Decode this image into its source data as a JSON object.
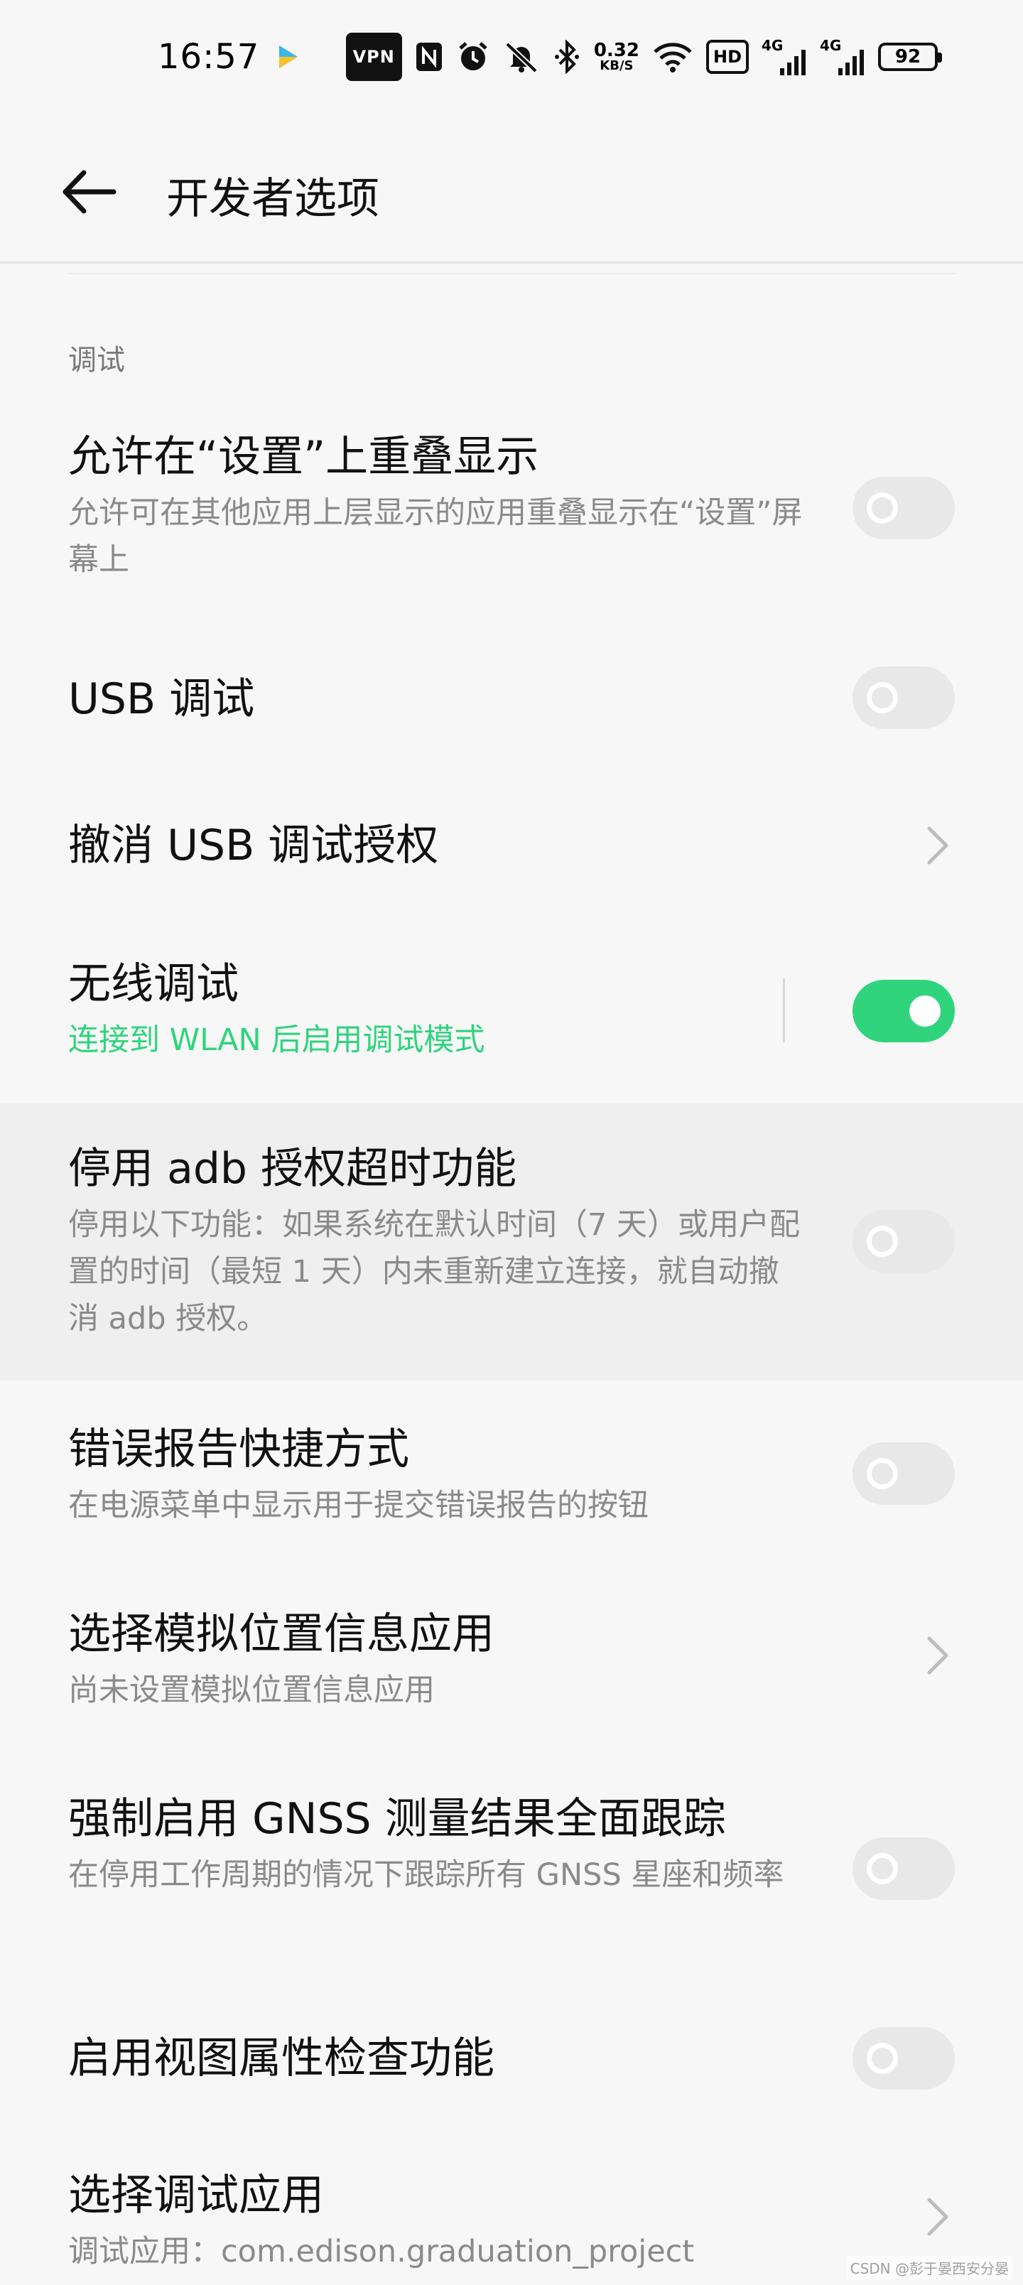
{
  "status_bar": {
    "time": "16:57",
    "vpn": "VPN",
    "net_speed_value": "0.32",
    "net_speed_unit": "KB/S",
    "hd": "HD",
    "signal1_label": "4G",
    "signal2_label": "4G",
    "battery": "92",
    "icons": [
      "play-icon",
      "nfc-icon",
      "alarm-icon",
      "mute-icon",
      "bluetooth-icon",
      "wifi-icon"
    ]
  },
  "header": {
    "title": "开发者选项"
  },
  "section": {
    "title": "调试"
  },
  "items": [
    {
      "title": "允许在“设置”上重叠显示",
      "subtitle": "允许可在其他应用上层显示的应用重叠显示在“设置”屏幕上",
      "control": "toggle",
      "state": "off"
    },
    {
      "title": "USB 调试",
      "subtitle": "",
      "control": "toggle",
      "state": "off"
    },
    {
      "title": "撤消 USB 调试授权",
      "subtitle": "",
      "control": "chevron"
    },
    {
      "title": "无线调试",
      "subtitle": "连接到 WLAN 后启用调试模式",
      "control": "toggle",
      "state": "on"
    },
    {
      "title": "停用 adb 授权超时功能",
      "subtitle": "停用以下功能：如果系统在默认时间（7 天）或用户配置的时间（最短 1 天）内未重新建立连接，就自动撤消 adb 授权。",
      "control": "toggle",
      "state": "off"
    },
    {
      "title": "错误报告快捷方式",
      "subtitle": "在电源菜单中显示用于提交错误报告的按钮",
      "control": "toggle",
      "state": "off"
    },
    {
      "title": "选择模拟位置信息应用",
      "subtitle": "尚未设置模拟位置信息应用",
      "control": "chevron"
    },
    {
      "title": "强制启用 GNSS 测量结果全面跟踪",
      "subtitle": "在停用工作周期的情况下跟踪所有 GNSS 星座和频率",
      "control": "toggle",
      "state": "off"
    },
    {
      "title": "启用视图属性检查功能",
      "subtitle": "",
      "control": "toggle",
      "state": "off"
    },
    {
      "title": "选择调试应用",
      "subtitle": "调试应用：com.edison.graduation_project",
      "control": "chevron"
    }
  ],
  "colors": {
    "accent": "#2fd47d",
    "toggle_off": "#e8e8e8",
    "background": "#f7f7f7"
  },
  "watermark": "CSDN @彭于晏西安分晏"
}
